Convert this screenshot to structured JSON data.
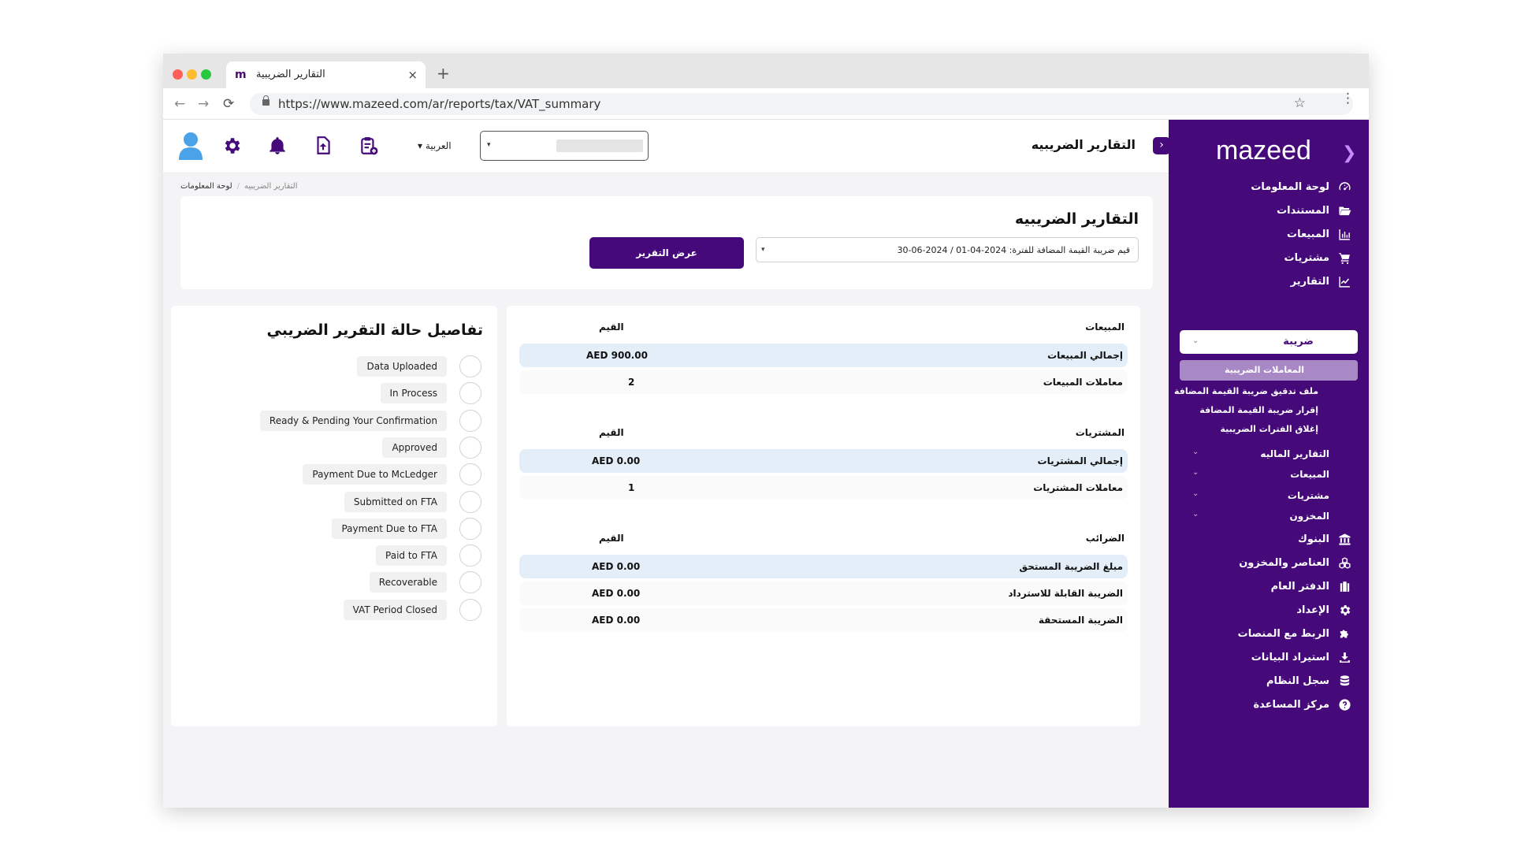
{
  "browser": {
    "tab_logo": "m",
    "tab_title": "التقارير الضريبية",
    "tab_close": "×",
    "new_tab": "+",
    "url": "https://www.mazeed.com/ar/reports/tax/VAT_summary",
    "back": "←",
    "forward": "→",
    "reload": "⟳",
    "star": "☆",
    "menu": "⋮"
  },
  "sidebar": {
    "brand": "mazeed",
    "brand_chevron": "❯",
    "items": [
      {
        "label": "لوحة المعلومات",
        "icon": "dashboard-icon"
      },
      {
        "label": "المستندات",
        "icon": "folder-icon"
      },
      {
        "label": "المبيعات",
        "icon": "bar-chart-icon"
      },
      {
        "label": "مشتريات",
        "icon": "cart-icon"
      },
      {
        "label": "التقارير",
        "icon": "line-chart-icon"
      }
    ],
    "select_label": "ضريبة",
    "select_caret": "⌄",
    "active_sub": "المعاملات الضريبية",
    "sub_items": [
      "ملف تدقيق ضريبة القيمة المضافة",
      "إقرار ضريبة القيمة المضافة",
      "إغلاق الفترات الضريبية"
    ],
    "group_items": [
      {
        "label": "التقارير الماليه",
        "caret": "⌄"
      },
      {
        "label": "المبيعات",
        "caret": "⌄"
      },
      {
        "label": "مشتريات",
        "caret": "⌄"
      },
      {
        "label": "المخزون",
        "caret": "⌄"
      }
    ],
    "bottom_items": [
      {
        "label": "البنوك",
        "icon": "bank-icon"
      },
      {
        "label": "العناصر والمخزون",
        "icon": "boxes-icon"
      },
      {
        "label": "الدفتر العام",
        "icon": "ledger-icon"
      },
      {
        "label": "الإعداد",
        "icon": "gear-icon"
      },
      {
        "label": "الربط مع المنصات",
        "icon": "puzzle-icon"
      },
      {
        "label": "استيراد البيانات",
        "icon": "download-icon"
      },
      {
        "label": "سجل النظام",
        "icon": "database-icon"
      },
      {
        "label": "مركز المساعدة",
        "icon": "help-icon"
      }
    ]
  },
  "header": {
    "collapse": "›",
    "title": "التقارير الضريبيه",
    "company_caret": "▾",
    "language": "▾ العربية"
  },
  "breadcrumb": {
    "home": "لوحة المعلومات",
    "separator": "/",
    "current": "التقارير الضريبيه"
  },
  "filter": {
    "title": "التقارير الضريبيه",
    "period_text": "قيم ضريبة القيمة المضافة للفترة: 2024-04-01 / 2024-06-30",
    "period_caret": "▾",
    "button": "عرض التقرير"
  },
  "summary": {
    "sections": [
      {
        "heading": "المبيعات",
        "values_heading": "القيم",
        "rows": [
          {
            "label": "إجمالي المبيعات",
            "value": "AED 900.00",
            "highlight": true
          },
          {
            "label": "معاملات المبيعات",
            "value": "2",
            "highlight": false
          }
        ]
      },
      {
        "heading": "المشتريات",
        "values_heading": "القيم",
        "rows": [
          {
            "label": "إجمالي المشتريات",
            "value": "AED 0.00",
            "highlight": true
          },
          {
            "label": "معاملات المشتريات",
            "value": "1",
            "highlight": false
          }
        ]
      },
      {
        "heading": "الضرائب",
        "values_heading": "القيم",
        "rows": [
          {
            "label": "مبلغ الضريبة المستحق",
            "value": "AED 0.00",
            "highlight": true
          },
          {
            "label": "الضريبة القابلة للاسترداد",
            "value": "AED 0.00",
            "highlight": false
          },
          {
            "label": "الضريبة المستحقة",
            "value": "AED 0.00",
            "highlight": false
          }
        ]
      }
    ]
  },
  "status": {
    "title": "تفاصيل حالة التقرير الضريبي",
    "items": [
      "Data Uploaded",
      "In Process",
      "Ready & Pending Your Confirmation",
      "Approved",
      "Payment Due to McLedger",
      "Submitted on FTA",
      "Payment Due to FTA",
      "Paid to FTA",
      "Recoverable",
      "VAT Period Closed"
    ]
  },
  "colors": {
    "brand_purple": "#45097a",
    "active_item": "#a889c6",
    "row_highlight": "#e3eef8",
    "avatar_blue": "#4aa3e8"
  }
}
